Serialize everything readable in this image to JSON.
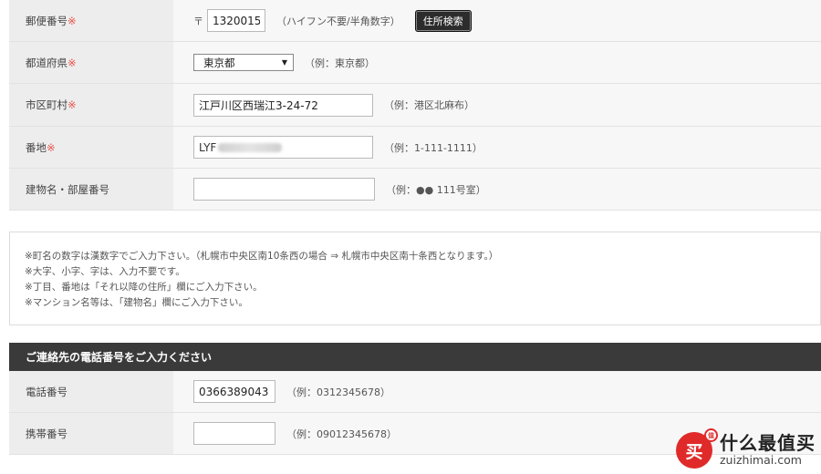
{
  "address_form": {
    "required_mark": "※",
    "postal": {
      "label": "郵便番号",
      "prefix": "〒",
      "value": "1320015",
      "hint": "（ハイフン不要/半角数字）",
      "search_button": "住所検索"
    },
    "prefecture": {
      "label": "都道府県",
      "selected": "東京都",
      "hint": "（例：東京都）"
    },
    "city": {
      "label": "市区町村",
      "value": "江戸川区西瑞江3-24-72",
      "hint": "（例：港区北麻布）"
    },
    "street": {
      "label": "番地",
      "value": "LYF",
      "hint": "（例：1-111-1111）"
    },
    "building": {
      "label": "建物名・部屋番号",
      "value": "",
      "hint": "（例：●● 111号室）"
    }
  },
  "notes": [
    "※町名の数字は漢数字でご入力下さい。（札幌市中央区南10条西の場合 ⇒ 札幌市中央区南十条西となります。）",
    "※大字、小字、字は、入力不要です。",
    "※丁目、番地は「それ以降の住所」欄にご入力下さい。",
    "※マンション名等は、「建物名」欄にご入力下さい。"
  ],
  "contact_section": {
    "title": "ご連絡先の電話番号をご入力ください",
    "phone": {
      "label": "電話番号",
      "value": "0366389043",
      "hint": "（例：0312345678）"
    },
    "mobile": {
      "label": "携帯番号",
      "value": "",
      "hint": "（例：09012345678）"
    }
  },
  "watermark": {
    "logo_char": "买",
    "badge": "值",
    "cn": "什么最值买",
    "en": "zuizhimai.com"
  }
}
